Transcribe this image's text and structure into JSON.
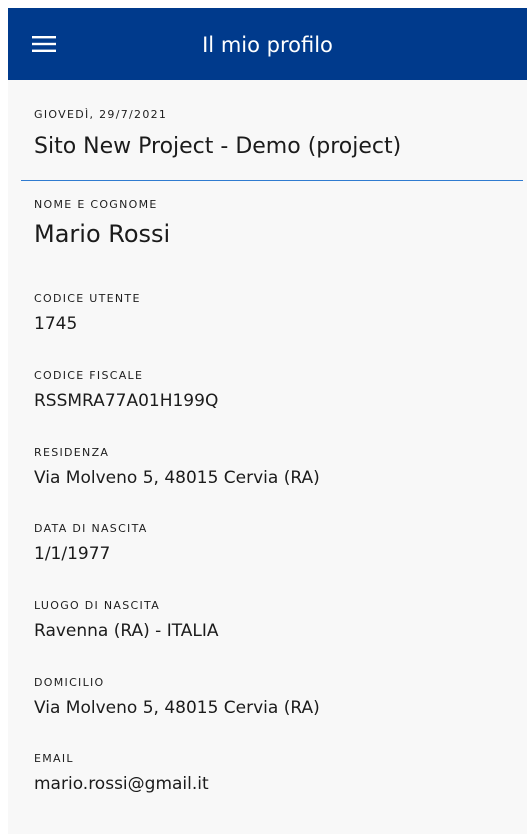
{
  "appbar": {
    "title": "Il mio profilo",
    "menu_icon": "menu-icon",
    "background": "#003a8c"
  },
  "header": {
    "date": "GIOVEDÌ, 29/7/2021",
    "site": "Sito New Project - Demo (project)"
  },
  "accent_color": "#2f7bd0",
  "profile": {
    "name_label": "NOME E COGNOME",
    "name_value": "Mario Rossi",
    "user_code_label": "CODICE UTENTE",
    "user_code_value": "1745",
    "tax_code_label": "CODICE FISCALE",
    "tax_code_value": "RSSMRA77A01H199Q",
    "residence_label": "RESIDENZA",
    "residence_value": "Via Molveno 5, 48015 Cervia (RA)",
    "birth_date_label": "DATA DI NASCITA",
    "birth_date_value": "1/1/1977",
    "birth_place_label": "LUOGO DI NASCITA",
    "birth_place_value": "Ravenna (RA) - ITALIA",
    "domicile_label": "DOMICILIO",
    "domicile_value": "Via Molveno 5, 48015 Cervia (RA)",
    "email_label": "EMAIL",
    "email_value": "mario.rossi@gmail.it"
  }
}
